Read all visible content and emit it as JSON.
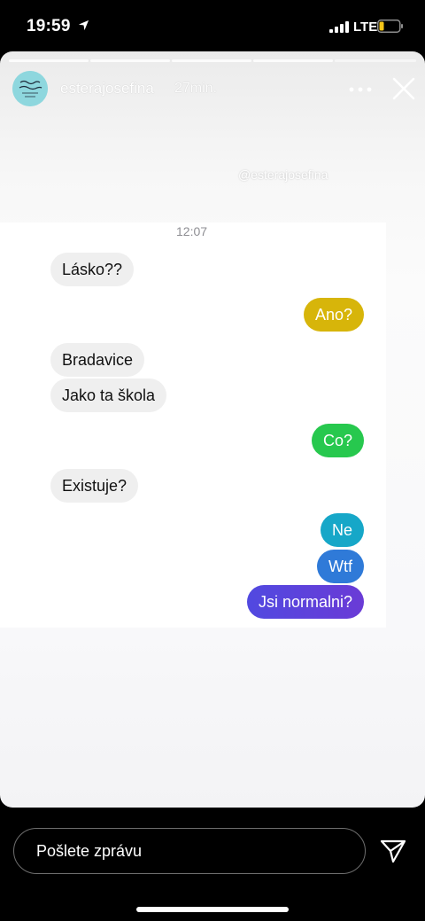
{
  "status_bar": {
    "time": "19:59",
    "network": "LTE"
  },
  "story": {
    "username": "esterajosefina",
    "time_ago": "27min.",
    "watermark": "@esterajosefina",
    "chat": {
      "timestamp": "12:07",
      "messages": [
        {
          "side": "incoming",
          "text": "Lásko??"
        },
        {
          "side": "outgoing",
          "text": "Ano?",
          "color": "#d7b50a"
        },
        {
          "side": "incoming",
          "text": "Bradavice"
        },
        {
          "side": "incoming",
          "text": "Jako ta škola"
        },
        {
          "side": "outgoing",
          "text": "Co?",
          "color": "#27c84e"
        },
        {
          "side": "incoming",
          "text": "Existuje?"
        },
        {
          "side": "outgoing",
          "text": "Ne",
          "color": "#16a7c8"
        },
        {
          "side": "outgoing",
          "text": "Wtf",
          "color": "#2f7ad8"
        },
        {
          "side": "outgoing",
          "text": "Jsi normalni?",
          "color": "#5149e0"
        }
      ]
    }
  },
  "reply": {
    "placeholder": "Pošlete zprávu"
  },
  "icons": {
    "location": "location-arrow-icon",
    "signal": "signal-icon",
    "battery": "battery-icon",
    "more": "more-icon",
    "close": "close-icon",
    "send": "send-icon"
  },
  "colors": {
    "battery_fill": "#f5c518",
    "last_bubble_gradient_end": "#6a3bd6"
  }
}
